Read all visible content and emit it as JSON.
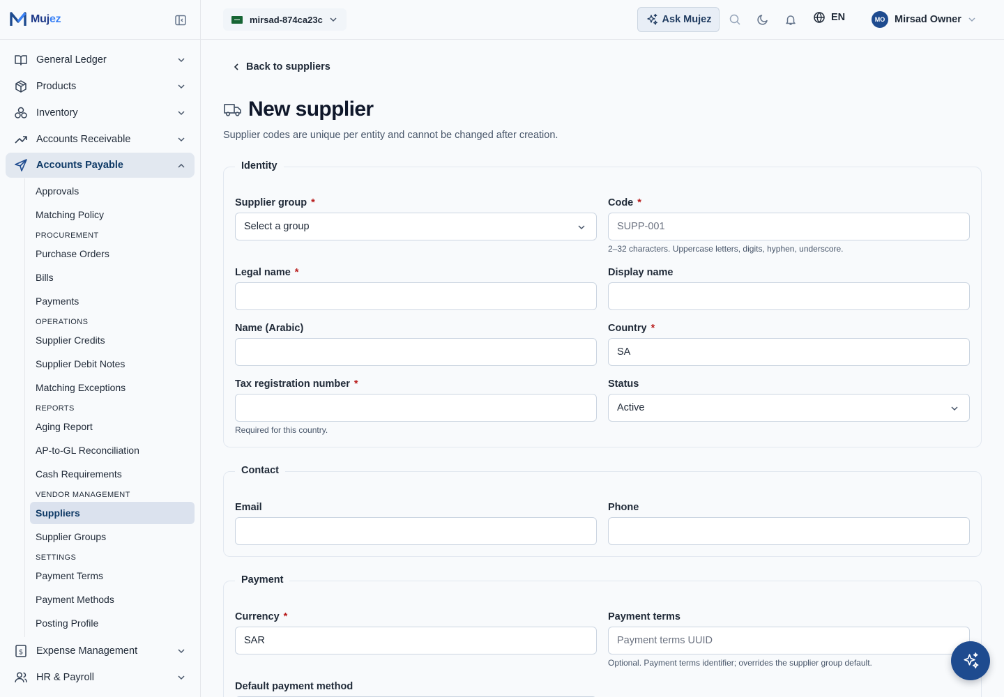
{
  "brand": {
    "name_main": "Muj",
    "name_accent": "ez"
  },
  "topbar": {
    "entity": "mirsad-874ca23c",
    "ask_label": "Ask Mujez",
    "language": "EN",
    "user_initials": "MO",
    "user_name": "Mirsad Owner"
  },
  "sidebar": {
    "modules": [
      {
        "label": "General Ledger",
        "icon": "book-icon"
      },
      {
        "label": "Products",
        "icon": "box-icon"
      },
      {
        "label": "Inventory",
        "icon": "boxes-icon"
      },
      {
        "label": "Accounts Receivable",
        "icon": "trending-up-icon"
      },
      {
        "label": "Accounts Payable",
        "icon": "send-icon"
      },
      {
        "label": "Expense Management",
        "icon": "receipt-icon"
      },
      {
        "label": "HR & Payroll",
        "icon": "users-icon"
      }
    ],
    "ap": {
      "approvals": "Approvals",
      "matching_policy": "Matching Policy",
      "procurement": "PROCUREMENT",
      "purchase_orders": "Purchase Orders",
      "bills": "Bills",
      "payments": "Payments",
      "operations": "OPERATIONS",
      "supplier_credits": "Supplier Credits",
      "supplier_debit_notes": "Supplier Debit Notes",
      "matching_exceptions": "Matching Exceptions",
      "reports": "REPORTS",
      "aging_report": "Aging Report",
      "ap_gl_recon": "AP-to-GL Reconciliation",
      "cash_requirements": "Cash Requirements",
      "vendor_management": "VENDOR MANAGEMENT",
      "suppliers": "Suppliers",
      "supplier_groups": "Supplier Groups",
      "settings": "SETTINGS",
      "payment_terms": "Payment Terms",
      "payment_methods": "Payment Methods",
      "posting_profile": "Posting Profile"
    }
  },
  "page": {
    "back": "Back to suppliers",
    "title": "New supplier",
    "subtitle": "Supplier codes are unique per entity and cannot be changed after creation."
  },
  "identity": {
    "legend": "Identity",
    "supplier_group_label": "Supplier group",
    "supplier_group_value": "Select a group",
    "code_label": "Code",
    "code_placeholder": "SUPP-001",
    "code_help": "2–32 characters. Uppercase letters, digits, hyphen, underscore.",
    "legal_name_label": "Legal name",
    "legal_name_value": "",
    "display_name_label": "Display name",
    "display_name_value": "",
    "name_ar_label": "Name (Arabic)",
    "name_ar_value": "",
    "country_label": "Country",
    "country_value": "SA",
    "trn_label": "Tax registration number",
    "trn_value": "",
    "trn_help": "Required for this country.",
    "status_label": "Status",
    "status_value": "Active",
    "required_mark": "*"
  },
  "contact": {
    "legend": "Contact",
    "email_label": "Email",
    "email_value": "",
    "phone_label": "Phone",
    "phone_value": ""
  },
  "payment": {
    "legend": "Payment",
    "currency_label": "Currency",
    "currency_value": "SAR",
    "terms_label": "Payment terms",
    "terms_placeholder": "Payment terms UUID",
    "terms_help": "Optional. Payment terms identifier; overrides the supplier group default.",
    "method_label": "Default payment method"
  },
  "colors": {
    "primary": "#1e4b8f",
    "active_bg": "#e2e8f0",
    "required": "#b91c1c"
  }
}
